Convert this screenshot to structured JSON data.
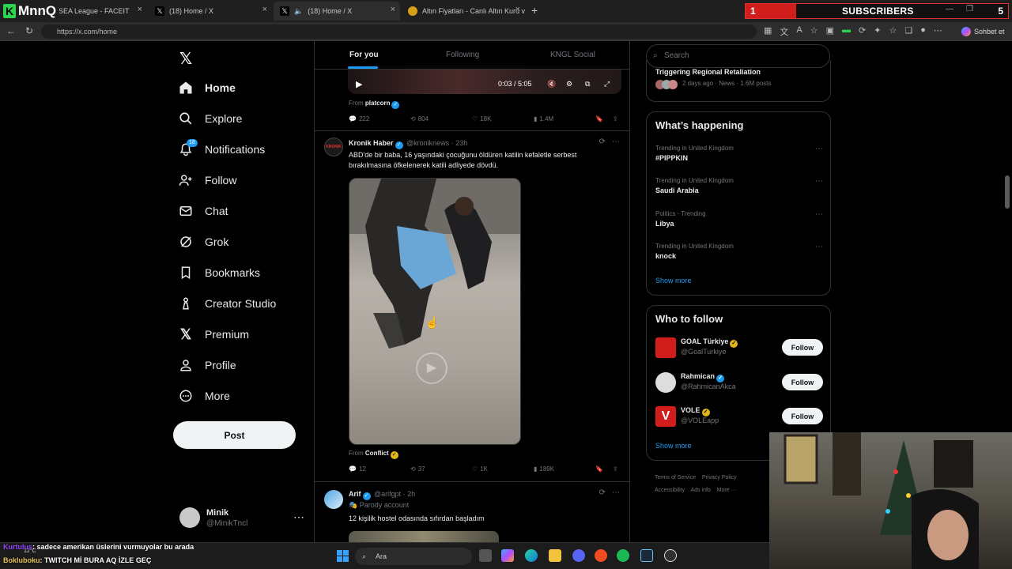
{
  "browser": {
    "brand": "MnnQ",
    "tabs": [
      {
        "label": "ESEA League - FACEIT"
      },
      {
        "label": "(18) Home / X"
      },
      {
        "label": "(18) Home / X"
      },
      {
        "label": "Altın Fiyatları - Canlı Altın Kuru ve"
      }
    ],
    "url": "https://x.com/home",
    "profile_button": "Sohbet et"
  },
  "subs": {
    "count": "1",
    "label": "SUBSCRIBERS",
    "goal": "5"
  },
  "nav": {
    "items": [
      {
        "label": "Home"
      },
      {
        "label": "Explore"
      },
      {
        "label": "Notifications",
        "badge": "18"
      },
      {
        "label": "Follow"
      },
      {
        "label": "Chat"
      },
      {
        "label": "Grok"
      },
      {
        "label": "Bookmarks"
      },
      {
        "label": "Creator Studio"
      },
      {
        "label": "Premium"
      },
      {
        "label": "Profile"
      },
      {
        "label": "More"
      }
    ],
    "post_button": "Post",
    "account": {
      "name": "Minik",
      "handle": "@MinikTncl"
    }
  },
  "feed": {
    "tabs": [
      "For you",
      "Following",
      "KNGL Social"
    ],
    "video": {
      "time": "0:03 / 5:05"
    },
    "post0": {
      "from_label": "From",
      "from_name": "platcorn",
      "replies": "222",
      "reposts": "804",
      "likes": "18K",
      "views": "1.4M"
    },
    "post1": {
      "name": "Kronik Haber",
      "handle": "@kroniknews",
      "time": "23h",
      "text": "ABD'de bir baba, 16 yaşındaki çocuğunu öldüren katilin kefaletle serbest bırakılmasına öfkelenerek katili adliyede dövdü.",
      "from_label": "From",
      "from_name": "Conflict",
      "replies": "12",
      "reposts": "37",
      "likes": "1K",
      "views": "189K"
    },
    "post2": {
      "name": "Arif",
      "handle": "@arifgpt",
      "time": "2h",
      "label": "Parody account",
      "text": "12 kişilik hostel odasında sıfırdan başladım"
    }
  },
  "right": {
    "search_placeholder": "Search",
    "top_item": {
      "title": "Triggering Regional Retaliation",
      "meta": "2 days ago · News · 1.6M posts"
    },
    "happening": {
      "title": "What’s happening",
      "items": [
        {
          "context": "Trending in United Kingdom",
          "topic": "#PIPPKIN"
        },
        {
          "context": "Trending in United Kingdom",
          "topic": "Saudi Arabia"
        },
        {
          "context": "Politics · Trending",
          "topic": "Libya"
        },
        {
          "context": "Trending in United Kingdom",
          "topic": "knock"
        }
      ],
      "show_more": "Show more"
    },
    "who_to_follow": {
      "title": "Who to follow",
      "items": [
        {
          "name": "GOAL Türkiye",
          "handle": "@GoalTurkiye",
          "button": "Follow"
        },
        {
          "name": "Rahmican",
          "handle": "@RahmicanAkca",
          "button": "Follow"
        },
        {
          "name": "VOLE",
          "handle": "@VOLEapp",
          "button": "Follow"
        }
      ],
      "show_more": "Show more"
    },
    "footer": [
      "Terms of Service",
      "Privacy Policy",
      "Accessibility",
      "Ads info",
      "More ···"
    ]
  },
  "stream_chat": [
    {
      "user": "Kurtulus",
      "text": ": sadece amerikan üslerini vurmuyolar bu arada"
    },
    {
      "user": "Bokluboku",
      "text": ": TWITCH Mİ BURA AQ İZLE GEÇ"
    }
  ],
  "taskbar": {
    "search": "Ara",
    "weather": "12°C"
  }
}
